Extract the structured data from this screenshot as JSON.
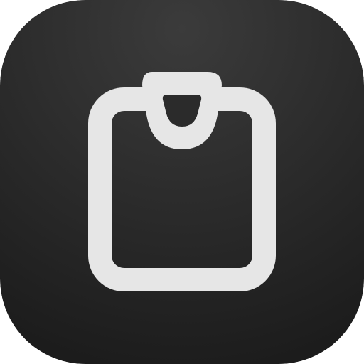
{
  "app_icon": {
    "icon_name": "clipboard-icon",
    "colors": {
      "background_light": "#3b3b3b",
      "background_dark": "#1c1c1c",
      "glyph": "#e6e6e6"
    }
  }
}
